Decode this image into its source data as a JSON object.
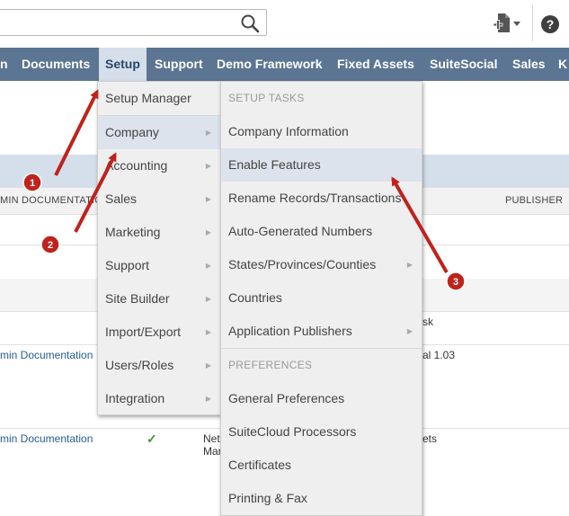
{
  "search": {
    "placeholder": "",
    "value": ""
  },
  "nav": {
    "items": [
      "n",
      "Documents",
      "Setup",
      "Support",
      "Demo Framework",
      "Fixed Assets",
      "SuiteSocial",
      "Sales",
      "K"
    ],
    "active": "Setup"
  },
  "background": {
    "col_admin": "MIN DOCUMENTATION",
    "col_publisher": "PUBLISHER",
    "row1_link": "min Documentation",
    "row1_right1": "sk",
    "row1_right2": "al 1.03",
    "row2_link": "min Documentation",
    "row2_check": "✓",
    "row2_mid1": "Nets",
    "row2_mid2": "Mar",
    "row2_right": "ets"
  },
  "setup_menu": {
    "items": [
      "Setup Manager",
      "Company",
      "Accounting",
      "Sales",
      "Marketing",
      "Support",
      "Site Builder",
      "Import/Export",
      "Users/Roles",
      "Integration"
    ]
  },
  "company_menu": {
    "section_tasks": "SETUP TASKS",
    "tasks": [
      "Company Information",
      "Enable Features",
      "Rename Records/Transactions",
      "Auto-Generated Numbers",
      "States/Provinces/Counties",
      "Countries",
      "Application Publishers"
    ],
    "section_prefs": "PREFERENCES",
    "prefs": [
      "General Preferences",
      "SuiteCloud Processors",
      "Certificates",
      "Printing & Fax"
    ]
  },
  "annotations": {
    "badges": [
      "1",
      "2",
      "3"
    ],
    "color": "#c0221c"
  },
  "icons": {
    "search": "search-icon",
    "add_document": "add-document-icon",
    "help": "help-icon",
    "submenu": "chevron-right-icon"
  },
  "colors": {
    "nav_bg": "#5b7593",
    "nav_active_bg": "#d5dfe9",
    "menu_bg": "#efefef",
    "menu_highlight": "#dde3ec"
  }
}
